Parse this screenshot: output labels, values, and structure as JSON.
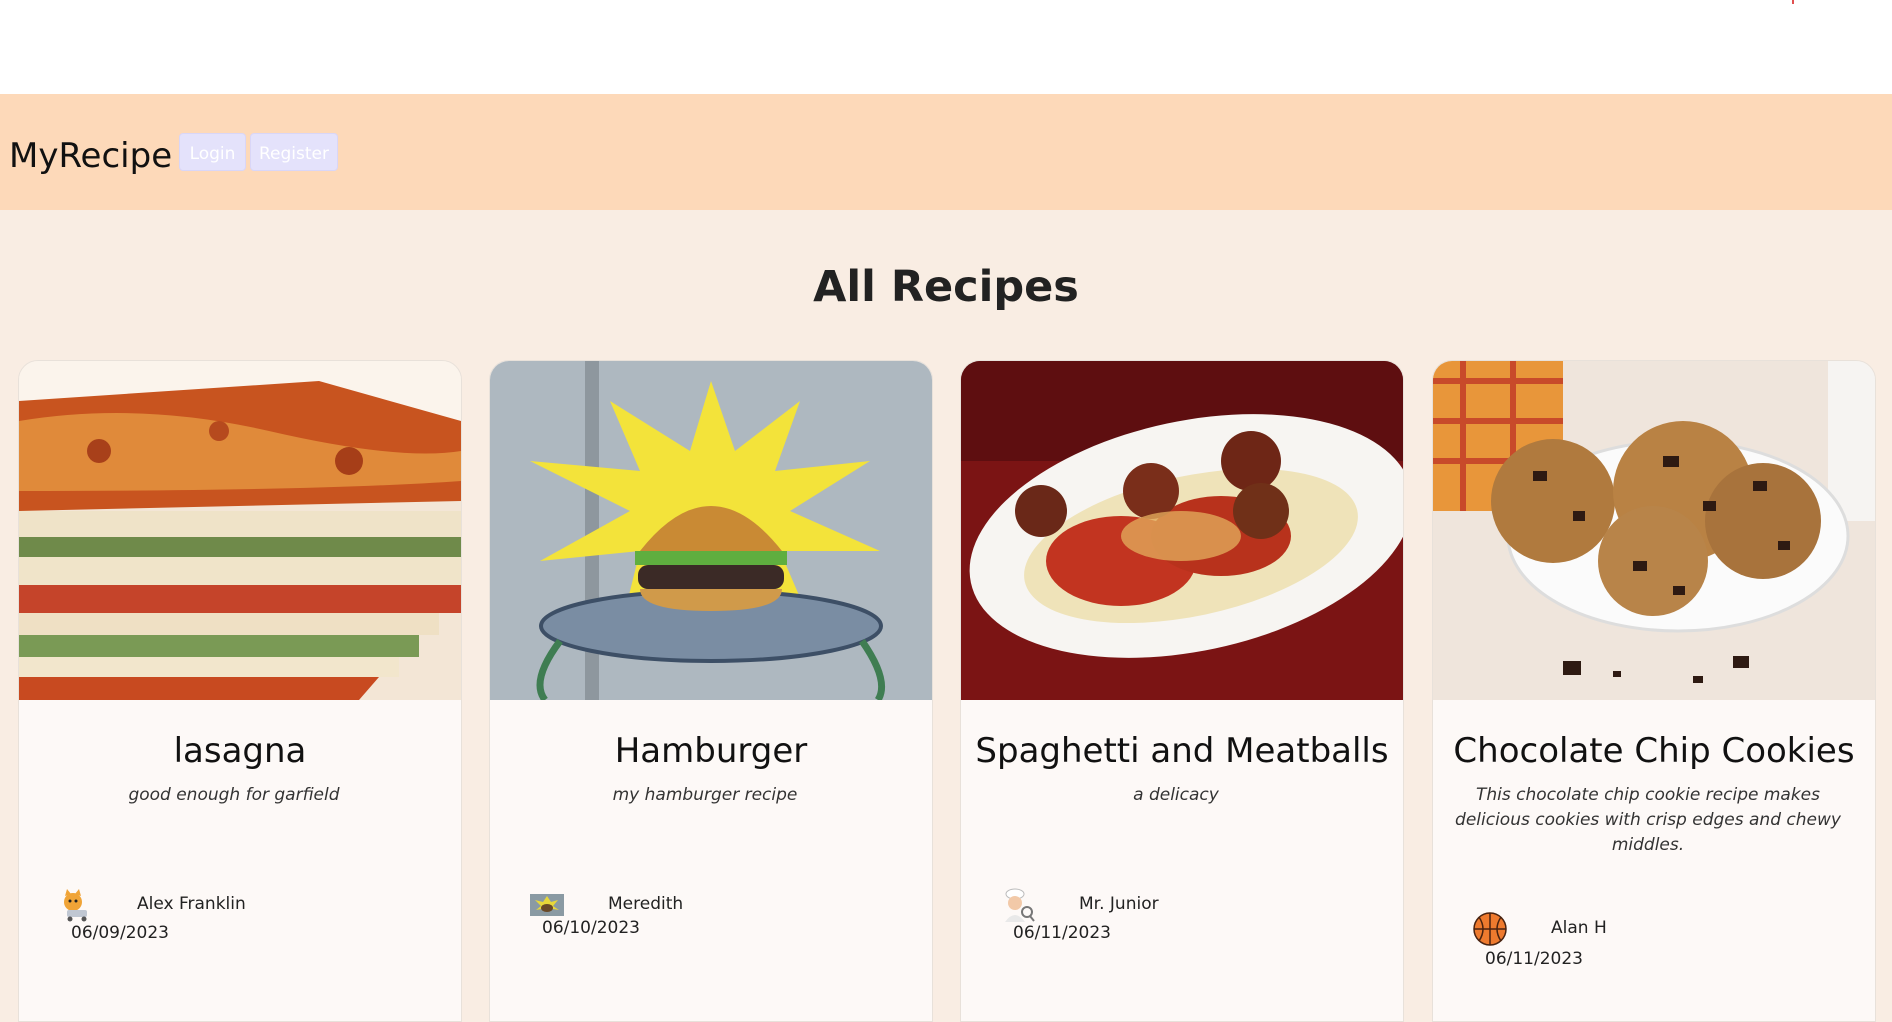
{
  "navbar": {
    "brand": "MyRecipe",
    "login_label": "Login",
    "register_label": "Register"
  },
  "page": {
    "heading": "All Recipes"
  },
  "recipes": [
    {
      "title": "lasagna",
      "description": "good enough for garfield",
      "author": "Alex Franklin",
      "date": "06/09/2023",
      "image": "lasagna-photo",
      "avatar": "cat-avatar"
    },
    {
      "title": "Hamburger",
      "description": "my hamburger recipe",
      "author": "Meredith",
      "date": "06/10/2023",
      "image": "cartoon-burger-image",
      "avatar": "burger-thumbnail-avatar"
    },
    {
      "title": "Spaghetti and Meatballs",
      "description": "a delicacy",
      "author": "Mr. Junior",
      "date": "06/11/2023",
      "image": "spaghetti-meatballs-photo",
      "avatar": "chef-avatar"
    },
    {
      "title": "Chocolate Chip Cookies",
      "description": "This chocolate chip cookie recipe makes delicious cookies with crisp edges and chewy middles.",
      "author": "Alan H",
      "date": "06/11/2023",
      "image": "cookies-photo",
      "avatar": "basketball-avatar"
    }
  ],
  "colors": {
    "navbar_bg": "#fdd9b9",
    "page_bg": "#f9ede3",
    "button_bg": "#e4e2fb"
  }
}
